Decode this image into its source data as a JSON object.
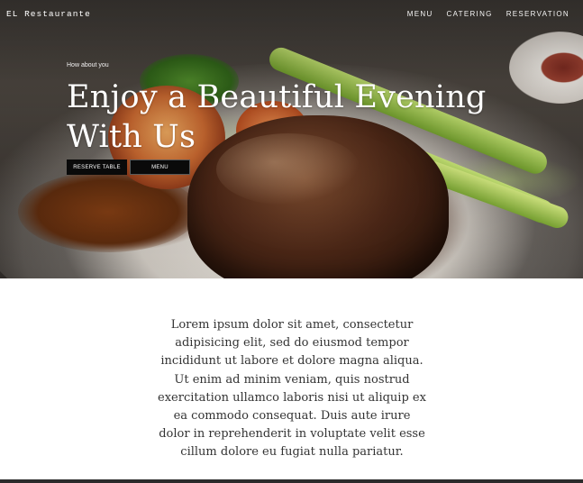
{
  "nav": {
    "brand": "EL Restaurante",
    "links": [
      "MENU",
      "CATERING",
      "RESERVATION"
    ]
  },
  "hero": {
    "eyebrow": "How about you",
    "headline_line1": "Enjoy a Beautiful Evening",
    "headline_line2": "With Us",
    "buttons": {
      "reserve": "RESERVE TABLE",
      "menu": "MENU"
    }
  },
  "intro": {
    "text": "Lorem ipsum dolor sit amet, consectetur adipisicing elit, sed do eiusmod tempor incididunt ut labore et dolore magna aliqua. Ut enim ad minim veniam, quis nostrud exercitation ullamco laboris nisi ut aliquip ex ea commodo consequat. Duis aute irure dolor in reprehenderit in voluptate velit esse cillum dolore eu fugiat nulla pariatur."
  }
}
